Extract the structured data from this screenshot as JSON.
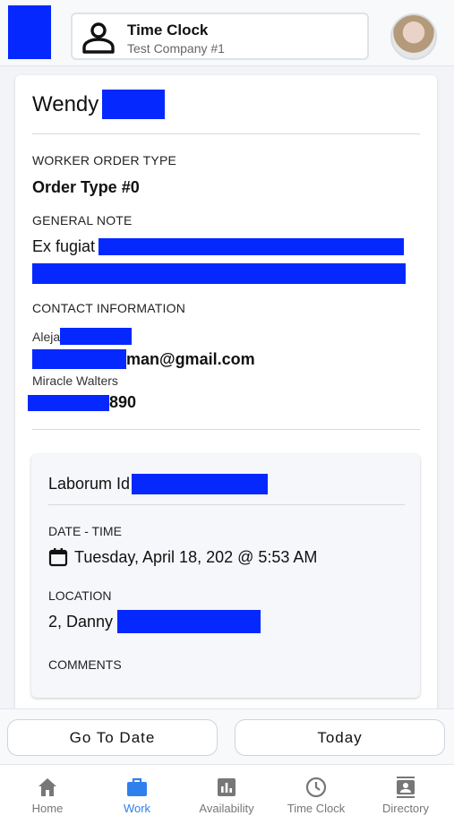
{
  "header": {
    "app_title": "Time Clock",
    "company": "Test Company #1"
  },
  "worker": {
    "first_name": "Wendy"
  },
  "sections": {
    "order_type_label": "WORKER ORDER TYPE",
    "order_type_value": "Order Type #0",
    "general_note_label": "GENERAL NOTE",
    "general_note_value": "Ex fugiat",
    "contact_label": "CONTACT INFORMATION",
    "contact_name_1": "Aleja",
    "contact_email_suffix": "man@gmail.com",
    "contact_name_2": "Miracle Walters",
    "contact_phone_suffix": "890"
  },
  "job": {
    "title": "Laborum Id",
    "date_label": "DATE - TIME",
    "date_value": "Tuesday, April 18, 202",
    "time_value": "@ 5:53 AM",
    "location_label": "LOCATION",
    "location_value": "2, Danny",
    "comments_label": "COMMENTS"
  },
  "buttons": {
    "go_to_date": "Go To Date",
    "today": "Today"
  },
  "nav": {
    "items": [
      {
        "label": "Home",
        "icon": "home-icon"
      },
      {
        "label": "Work",
        "icon": "briefcase-icon"
      },
      {
        "label": "Availability",
        "icon": "bar-chart-icon"
      },
      {
        "label": "Time Clock",
        "icon": "clock-icon"
      },
      {
        "label": "Directory",
        "icon": "contact-book-icon"
      }
    ],
    "active_index": 1
  },
  "colors": {
    "redaction": "#0528ff",
    "active_nav": "#2f80ed",
    "inactive_nav": "#777777"
  }
}
